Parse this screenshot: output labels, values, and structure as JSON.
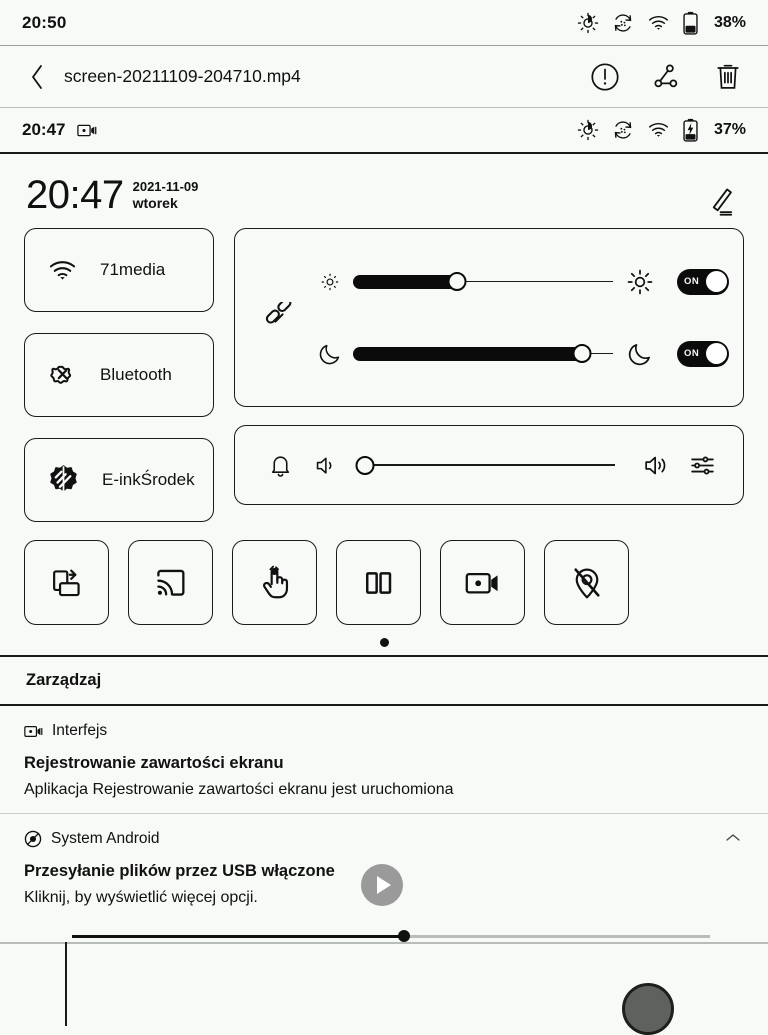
{
  "system_status_bar": {
    "clock": "20:50",
    "battery_percent": "38%",
    "icons": [
      "brightness-icon",
      "refresh-dots-icon",
      "wifi-icon",
      "battery-icon"
    ]
  },
  "app_toolbar": {
    "back_label": "‹",
    "title": "screen-20211109-204710.mp4",
    "actions": [
      {
        "name": "info-icon",
        "label": "Info"
      },
      {
        "name": "share-icon",
        "label": "Share"
      },
      {
        "name": "delete-icon",
        "label": "Delete"
      }
    ]
  },
  "shade": {
    "status_bar": {
      "clock": "20:47",
      "recording_icon": "screen-record-icon",
      "battery_percent": "37%",
      "battery_state": "charging"
    },
    "header": {
      "time": "20:47",
      "date": "2021-11-09",
      "weekday": "wtorek",
      "edit_icon": "edit-pencil-icon"
    },
    "quick_tiles": [
      {
        "icon": "wifi-icon",
        "label": "71media"
      },
      {
        "icon": "bluetooth-off-icon",
        "label": "Bluetooth"
      },
      {
        "icon": "eink-contrast-icon",
        "label": "E-inkŚrodek"
      }
    ],
    "brightness_panel": {
      "link_icon": "link-icon",
      "rows": [
        {
          "start_icon": "brightness-low-icon",
          "end_icon": "brightness-high-icon",
          "value": 40,
          "toggle_label": "ON",
          "toggle_on": true,
          "name": "front-light-brightness"
        },
        {
          "start_icon": "moon-icon",
          "end_icon": "moon-icon",
          "value": 88,
          "toggle_label": "ON",
          "toggle_on": true,
          "name": "warm-light-brightness"
        }
      ]
    },
    "volume_panel": {
      "bell_icon": "bell-icon",
      "low_icon": "volume-low-icon",
      "high_icon": "volume-high-icon",
      "settings_icon": "sliders-icon",
      "value": 0
    },
    "action_tiles": [
      {
        "icon": "rotate-screen-icon",
        "name": "rotate-screen"
      },
      {
        "icon": "cast-icon",
        "name": "cast-screen"
      },
      {
        "icon": "touch-icon",
        "name": "touch-lock"
      },
      {
        "icon": "split-screen-icon",
        "name": "split-screen"
      },
      {
        "icon": "screen-record-icon",
        "name": "screen-record"
      },
      {
        "icon": "location-off-icon",
        "name": "location-off"
      }
    ],
    "page_indicator": {
      "pages": 1,
      "active": 0
    },
    "manage_label": "Zarządzaj",
    "notifications": [
      {
        "app_icon": "screen-record-icon",
        "app_name": "Interfejs",
        "title": "Rejestrowanie zawartości ekranu",
        "body": "Aplikacja Rejestrowanie zawartości ekranu jest uruchomiona",
        "has_action_button": false,
        "collapsible": false
      },
      {
        "app_icon": "android-system-icon",
        "app_name": "System Android",
        "title": "Przesyłanie plików przez USB włączone",
        "body": "Kliknij, by wyświetlić więcej opcji.",
        "has_action_button": true,
        "action_button_icon": "play-icon",
        "collapsible": true,
        "collapse_icon": "chevron-up-icon"
      }
    ]
  },
  "video_player_behind": {
    "seek_progress": 52,
    "play_control": "home-button"
  }
}
